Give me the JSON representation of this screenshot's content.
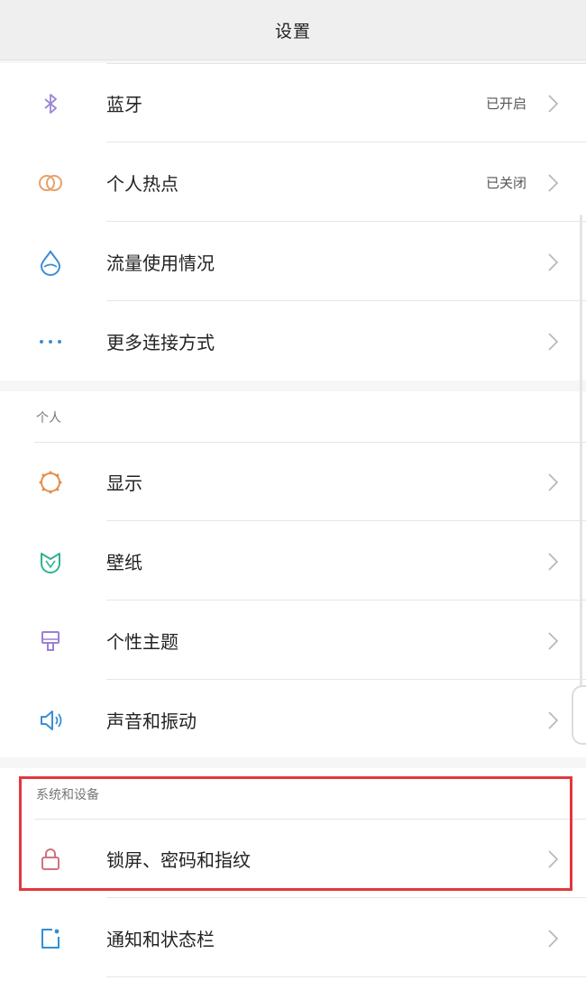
{
  "header": {
    "title": "设置"
  },
  "connection_group": {
    "items": [
      {
        "label": "蓝牙",
        "value": "已开启",
        "icon": "bluetooth-icon"
      },
      {
        "label": "个人热点",
        "value": "已关闭",
        "icon": "hotspot-icon"
      },
      {
        "label": "流量使用情况",
        "value": "",
        "icon": "data-usage-icon"
      },
      {
        "label": "更多连接方式",
        "value": "",
        "icon": "more-connections-icon"
      }
    ]
  },
  "personal_group": {
    "header": "个人",
    "items": [
      {
        "label": "显示",
        "icon": "display-icon"
      },
      {
        "label": "壁纸",
        "icon": "wallpaper-icon"
      },
      {
        "label": "个性主题",
        "icon": "theme-icon"
      },
      {
        "label": "声音和振动",
        "icon": "sound-icon"
      }
    ]
  },
  "system_group": {
    "header": "系统和设备",
    "items": [
      {
        "label": "锁屏、密码和指纹",
        "icon": "lock-icon"
      },
      {
        "label": "通知和状态栏",
        "icon": "notification-icon"
      }
    ]
  },
  "colors": {
    "highlight": "#e2373d",
    "bluetooth": "#9a86d6",
    "hotspot": "#e8a06a",
    "data": "#3b8ed6",
    "display": "#e28f4c",
    "wallpaper": "#2fb38f",
    "theme": "#9a7fd6",
    "sound": "#3b8ed6",
    "lock": "#d07380",
    "notification": "#2f8fd6"
  }
}
